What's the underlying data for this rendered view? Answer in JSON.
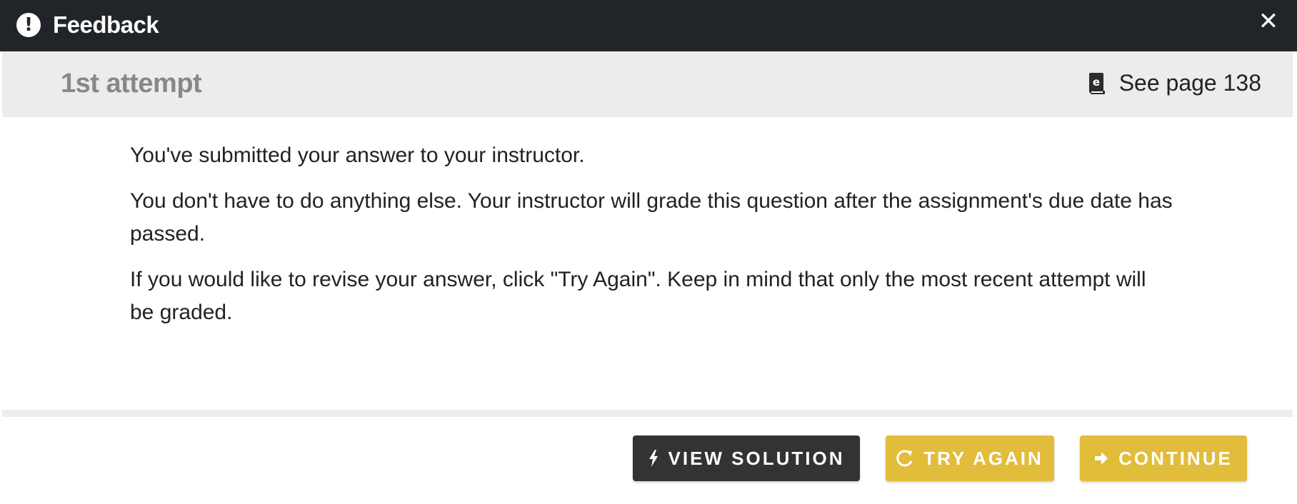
{
  "dialog": {
    "title": "Feedback",
    "alert_icon_glyph": "!",
    "close_glyph": "✕"
  },
  "attempt": {
    "label": "1st attempt",
    "page_reference": "See page 138",
    "book_icon": "ebook-icon"
  },
  "message": {
    "paragraphs": [
      "You've submitted your answer to your instructor.",
      "You don't have to do anything else. Your instructor will grade this question after the assignment's due date has passed.",
      "If you would like to revise your answer, click \"Try Again\". Keep in mind that only the most recent attempt will be graded."
    ]
  },
  "actions": {
    "view_solution": "VIEW SOLUTION",
    "try_again": "TRY AGAIN",
    "continue": "CONTINUE"
  },
  "colors": {
    "titlebar": "#212529",
    "attempt_bar": "#ececec",
    "dark_button": "#333333",
    "accent_button": "#e2bc3b"
  }
}
